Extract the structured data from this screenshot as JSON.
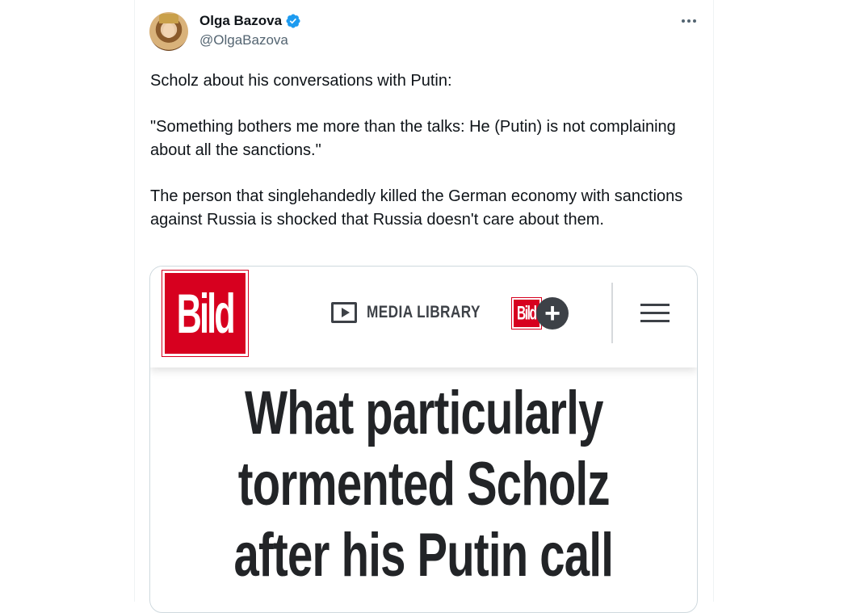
{
  "author": {
    "display_name": "Olga Bazova",
    "handle": "@OlgaBazova",
    "verified": true,
    "avatar": "avatar-photo"
  },
  "tweet": {
    "paragraphs": [
      "Scholz about his conversations with Putin:",
      "\"Something bothers me more than the talks: He (Putin) is not complaining about all the sanctions.\"",
      "The person that singlehandedly killed the German economy with sanctions against Russia is shocked that Russia doesn't care about them."
    ],
    "more_icon": "more-horizontal-icon"
  },
  "embedded_image": {
    "logo": "Bild",
    "media_library_label": "MEDIA LIBRARY",
    "bildplus_logo": "Bild",
    "bildplus_plus": "+",
    "headline_lines": [
      "What particularly",
      "tormented Scholz",
      "after his Putin call"
    ]
  },
  "colors": {
    "bild_red": "#d7001f",
    "verified_blue": "#1d9bf0",
    "text_primary": "#0f1419",
    "text_secondary": "#536471",
    "headline": "#222427"
  }
}
